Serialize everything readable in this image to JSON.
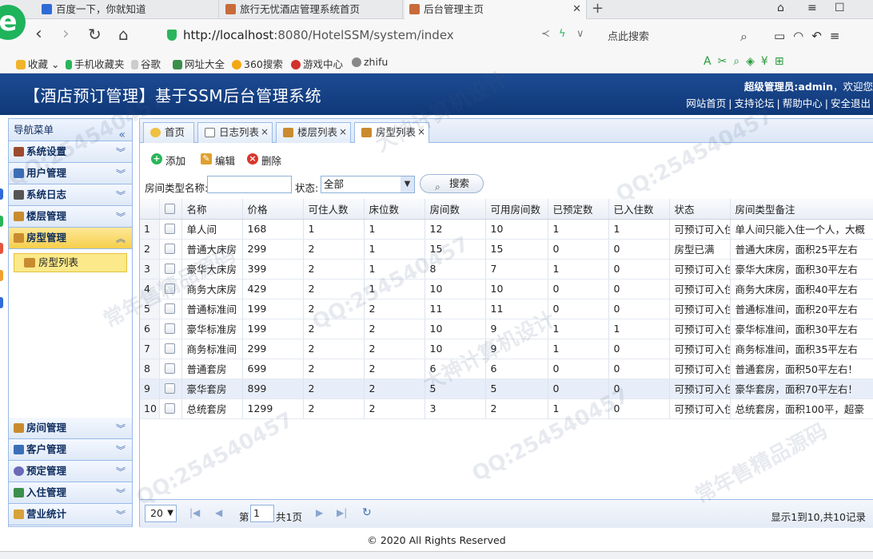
{
  "browser": {
    "tabs": [
      {
        "title": "百度一下，你就知道"
      },
      {
        "title": "旅行无忧酒店管理系统首页"
      },
      {
        "title": "后台管理主页"
      }
    ],
    "url_host": "http://localhost",
    "url_path": ":8080/HotelSSM/system/index",
    "search_hint": "点此搜索",
    "bookmarks": [
      "收藏",
      "手机收藏夹",
      "谷歌",
      "网址大全",
      "360搜索",
      "游戏中心",
      "zhifu"
    ]
  },
  "app": {
    "title": "【酒店预订管理】基于SSM后台管理系统",
    "user_role": "超级管理员:",
    "user_name": "admin",
    "welcome": "，欢迎您",
    "links": [
      "网站首页",
      "支持论坛",
      "帮助中心",
      "安全退出"
    ]
  },
  "sidebar": {
    "header": "导航菜单",
    "menus_top": [
      {
        "label": "系统设置",
        "color": "#9c4a2e"
      },
      {
        "label": "用户管理",
        "color": "#3a6fb8"
      },
      {
        "label": "系统日志",
        "color": "#555555"
      },
      {
        "label": "楼层管理",
        "color": "#c98b2f"
      }
    ],
    "open_menu": {
      "label": "房型管理",
      "color": "#c98b2f"
    },
    "submenu_item": "房型列表",
    "menus_bottom": [
      {
        "label": "房间管理",
        "color": "#c98b2f"
      },
      {
        "label": "客户管理",
        "color": "#3a6fb8"
      },
      {
        "label": "预定管理",
        "color": "#6a6ab8"
      },
      {
        "label": "入住管理",
        "color": "#3a8f4a"
      },
      {
        "label": "营业统计",
        "color": "#d8a23a"
      }
    ]
  },
  "panel_tabs": [
    "首页",
    "日志列表",
    "楼层列表",
    "房型列表"
  ],
  "toolbar": {
    "add": "添加",
    "edit": "编辑",
    "delete": "删除"
  },
  "filter": {
    "name_label": "房间类型名称:",
    "name_value": "",
    "status_label": "状态:",
    "status_value": "全部",
    "search_button": "搜索"
  },
  "table": {
    "columns": [
      "名称",
      "价格",
      "可住人数",
      "床位数",
      "房间数",
      "可用房间数",
      "已预定数",
      "已入住数",
      "状态",
      "房间类型备注"
    ],
    "rows": [
      [
        "单人间",
        "168",
        "1",
        "1",
        "12",
        "10",
        "1",
        "1",
        "可预订可入住",
        "单人间只能入住一个人，大概"
      ],
      [
        "普通大床房",
        "299",
        "2",
        "1",
        "15",
        "15",
        "0",
        "0",
        "房型已满",
        "普通大床房，面积25平左右"
      ],
      [
        "豪华大床房",
        "399",
        "2",
        "1",
        "8",
        "7",
        "1",
        "0",
        "可预订可入住",
        "豪华大床房，面积30平左右"
      ],
      [
        "商务大床房",
        "429",
        "2",
        "1",
        "10",
        "10",
        "0",
        "0",
        "可预订可入住",
        "商务大床房，面积40平左右"
      ],
      [
        "普通标准间",
        "199",
        "2",
        "2",
        "11",
        "11",
        "0",
        "0",
        "可预订可入住",
        "普通标准间，面积20平左右"
      ],
      [
        "豪华标准房",
        "199",
        "2",
        "2",
        "10",
        "9",
        "1",
        "1",
        "可预订可入住",
        "豪华标准间，面积30平左右"
      ],
      [
        "商务标准间",
        "299",
        "2",
        "2",
        "10",
        "9",
        "1",
        "0",
        "可预订可入住",
        "商务标准间，面积35平左右"
      ],
      [
        "普通套房",
        "699",
        "2",
        "2",
        "6",
        "6",
        "0",
        "0",
        "可预订可入住",
        "普通套房，面积50平左右！"
      ],
      [
        "豪华套房",
        "899",
        "2",
        "2",
        "5",
        "5",
        "0",
        "0",
        "可预订可入住",
        "豪华套房，面积70平左右！"
      ],
      [
        "总统套房",
        "1299",
        "2",
        "2",
        "3",
        "2",
        "1",
        "0",
        "可预订可入住",
        "总统套房，面积100平，超豪"
      ]
    ]
  },
  "pager": {
    "page_size": "20",
    "page_prefix": "第",
    "current_page": "1",
    "page_suffix": "共1页",
    "info": "显示1到10,共10记录"
  },
  "footer": "© 2020 All Rights Reserved",
  "watermarks": [
    "QQ:254540457",
    "常年售精品源码",
    "大神计算机设计"
  ]
}
